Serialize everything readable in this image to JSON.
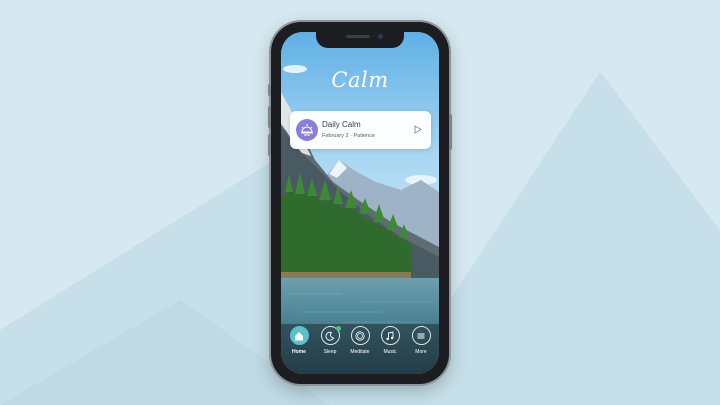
{
  "app": {
    "logo": "Calm"
  },
  "daily_card": {
    "title": "Daily Calm",
    "subtitle": "February 2 · Patience",
    "icon": "sunrise-icon"
  },
  "tabs": [
    {
      "label": "Home",
      "icon": "home-icon",
      "active": true
    },
    {
      "label": "Sleep",
      "icon": "moon-icon",
      "active": false
    },
    {
      "label": "Meditate",
      "icon": "meditate-icon",
      "active": false
    },
    {
      "label": "Music",
      "icon": "music-note-icon",
      "active": false
    },
    {
      "label": "More",
      "icon": "menu-icon",
      "active": false
    }
  ],
  "colors": {
    "background": "#d6e8f0",
    "accent": "#59c2c6",
    "card_icon": "#8a7fd8",
    "notification_dot": "#4cc67b"
  }
}
